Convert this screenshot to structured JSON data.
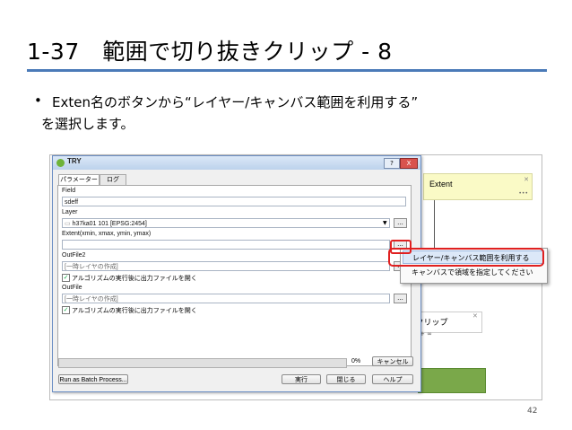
{
  "slide": {
    "title": "1-37　範囲で切り抜きクリップ - 8",
    "bullet_marker": "•",
    "bullet_line1": "Exten名のボタンから“レイヤー/キャンバス範囲を利用する”",
    "bullet_line2": "を選択します。",
    "page_number": "42",
    "accent_color": "#4a7ab8"
  },
  "modeler": {
    "extent_node": "Extent",
    "clip_node": "/クリップ",
    "node_close_icon": "close-icon"
  },
  "dialog": {
    "title": "TRY",
    "help_icon": "?",
    "close_icon": "X",
    "tabs": [
      "パラメーター",
      "ログ"
    ],
    "field_label": "Field",
    "field_value": "sdeff",
    "layer_label": "Layer",
    "layer_value": "h37ka01 101 [EPSG:2454]",
    "extent_label": "Extent(xmin, xmax, ymin, ymax)",
    "extent_value": "",
    "outfile2_label": "OutFile2",
    "outfile2_placeholder": "[一時レイヤの作成]",
    "outfile2_checkbox": "アルゴリズムの実行後に出力ファイルを開く",
    "outfile_label": "OutFile",
    "outfile_placeholder": "[一時レイヤの作成]",
    "outfile_checkbox": "アルゴリズムの実行後に出力ファイルを開く",
    "ellipsis": "...",
    "progress_text": "0%",
    "cancel_button": "キャンセル",
    "batch_button": "Run as Batch Process...",
    "run_button": "実行",
    "close_button": "閉じる",
    "help_button": "ヘルプ"
  },
  "context_menu": {
    "items": [
      "レイヤー/キャンバス範囲を利用する",
      "キャンバスで領域を指定してください"
    ],
    "highlight_color": "#e02020"
  }
}
